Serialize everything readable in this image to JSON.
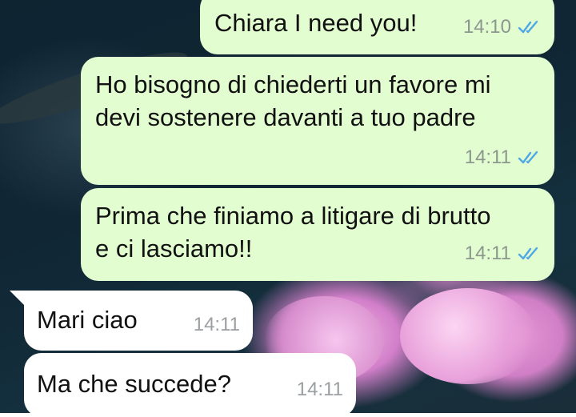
{
  "colors": {
    "outgoing_bubble": "#e2fdcf",
    "incoming_bubble": "#ffffff",
    "read_ticks": "#4fa8e6",
    "timestamp": "#8c978f"
  },
  "messages": [
    {
      "direction": "outgoing",
      "text": "Chiara I need you!",
      "time": "14:10",
      "status": "read",
      "status_icon": "double-check-icon"
    },
    {
      "direction": "outgoing",
      "text": "Ho bisogno di chiederti un favore mi devi sostenere davanti a tuo padre",
      "time": "14:11",
      "status": "read",
      "status_icon": "double-check-icon"
    },
    {
      "direction": "outgoing",
      "text": "Prima che finiamo a litigare di brutto e ci lasciamo!!",
      "time": "14:11",
      "status": "read",
      "status_icon": "double-check-icon"
    },
    {
      "direction": "incoming",
      "text": "Mari ciao",
      "time": "14:11"
    },
    {
      "direction": "incoming",
      "text": "Ma che succede?",
      "time": "14:11"
    }
  ]
}
